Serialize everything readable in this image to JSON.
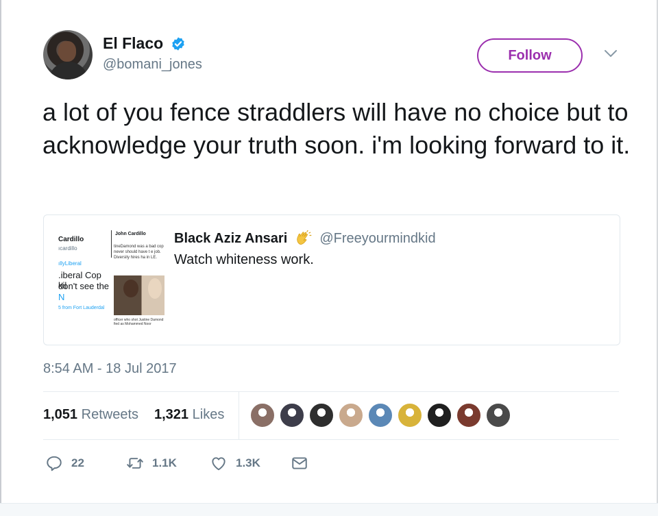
{
  "tweet": {
    "display_name": "El Flaco",
    "handle": "@bomani_jones",
    "follow_label": "Follow",
    "text": "a lot of you fence straddlers will have no choice but to acknowledge your truth soon. i'm looking forward to it.",
    "timestamp": "8:54 AM - 18 Jul 2017"
  },
  "quoted": {
    "author": "Black Aziz Ansari",
    "handle": "@Freeyourmindkid",
    "text": "Watch whiteness work.",
    "thumbnail": {
      "left_name": "Cardillo",
      "left_handle": "ıcardillo",
      "left_line1": "ıllyLiberal",
      "left_line2": ".iberal Cop kil",
      "left_line3": "don't see the",
      "left_line4": "N",
      "left_line5": "5 from Fort Lauderdal",
      "right_name": "John Cardillo",
      "right_text": "tineDamond was a bad cop never should have t e job. Diversity hires ha in LE.",
      "right_caption": "officer who shot Justine Damond fied as Mohammed Noor"
    }
  },
  "stats": {
    "retweets_count": "1,051",
    "retweets_label": "Retweets",
    "likes_count": "1,321",
    "likes_label": "Likes"
  },
  "likers": [
    {
      "color": "#8a6f66"
    },
    {
      "color": "#3d3d4a"
    },
    {
      "color": "#2e2e2e"
    },
    {
      "color": "#c9a98d"
    },
    {
      "color": "#5b88b6"
    },
    {
      "color": "#d8b33a"
    },
    {
      "color": "#1f1f1f"
    },
    {
      "color": "#7a3a2e"
    },
    {
      "color": "#4a4a4a"
    }
  ],
  "actions": {
    "reply_count": "22",
    "retweet_count": "1.1K",
    "like_count": "1.3K"
  },
  "colors": {
    "accent": "#9b2fae",
    "verified": "#1da1f2",
    "muted": "#657786"
  },
  "icons": [
    "verified-badge-icon",
    "chevron-down-icon",
    "clap-icon",
    "reply-icon",
    "retweet-icon",
    "heart-icon",
    "envelope-icon"
  ]
}
